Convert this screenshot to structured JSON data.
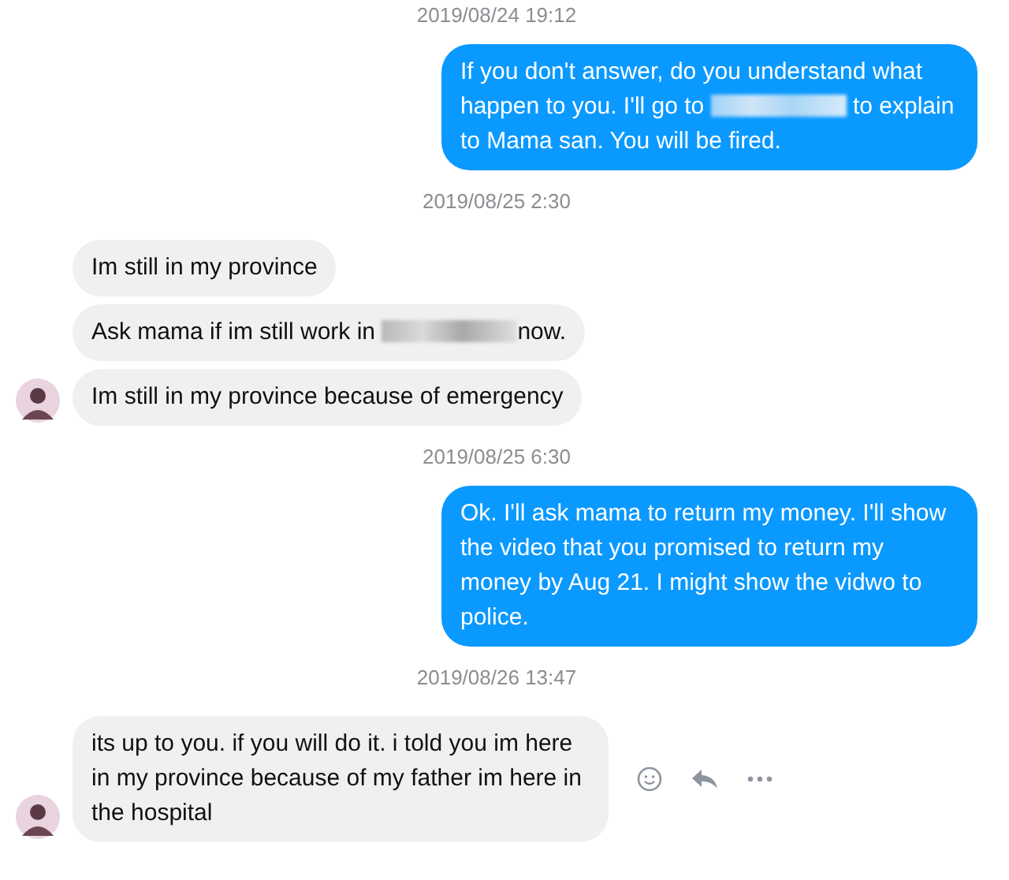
{
  "thread": [
    {
      "kind": "timestamp",
      "text": "2019/08/24 19:12"
    },
    {
      "kind": "outgoing",
      "messages": [
        {
          "parts": [
            {
              "kind": "text",
              "text": "If you don't answer, do you understand what happen to you. I'll go to "
            },
            {
              "kind": "redacted"
            },
            {
              "kind": "text",
              "text": " to explain to Mama san. You will be fired."
            }
          ]
        }
      ]
    },
    {
      "kind": "timestamp",
      "text": "2019/08/25 2:30"
    },
    {
      "kind": "incoming",
      "messages": [
        {
          "parts": [
            {
              "kind": "text",
              "text": "Im still in my province"
            }
          ]
        },
        {
          "parts": [
            {
              "kind": "text",
              "text": "Ask mama if im still work in "
            },
            {
              "kind": "redacted"
            },
            {
              "kind": "text",
              "text": "now."
            }
          ]
        },
        {
          "parts": [
            {
              "kind": "text",
              "text": "Im still in my province because of emergency"
            }
          ]
        }
      ]
    },
    {
      "kind": "timestamp",
      "text": "2019/08/25 6:30"
    },
    {
      "kind": "outgoing",
      "messages": [
        {
          "parts": [
            {
              "kind": "text",
              "text": "Ok. I'll ask mama to return my money. I'll show the video that you promised to return my money by Aug 21. I might show the vidwo to police."
            }
          ]
        }
      ]
    },
    {
      "kind": "timestamp",
      "text": "2019/08/26 13:47"
    },
    {
      "kind": "incoming",
      "actions_shown": true,
      "messages": [
        {
          "parts": [
            {
              "kind": "text",
              "text": "its up to you. if you will do it. i told you im here in my province because of my father im here in the hospital"
            }
          ]
        }
      ]
    }
  ]
}
